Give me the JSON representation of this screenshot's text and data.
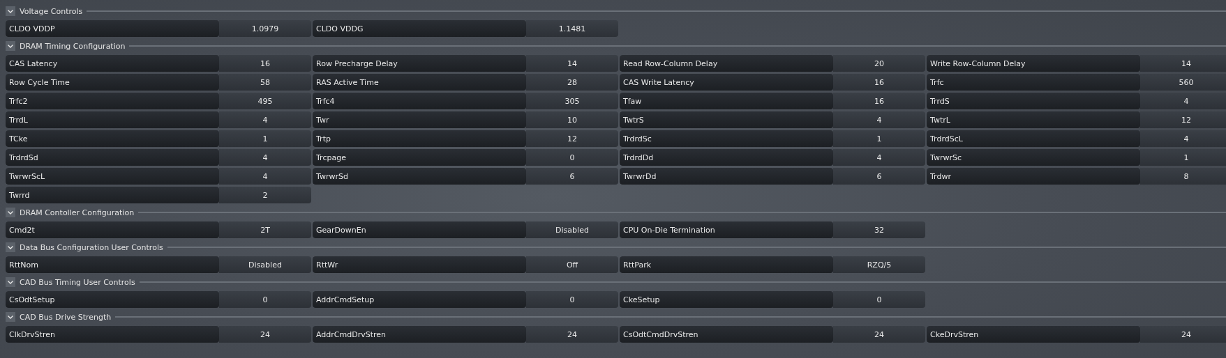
{
  "sections": [
    {
      "title": "Voltage Controls",
      "expanded": true,
      "items": [
        {
          "label": "CLDO VDDP",
          "value": "1.0979"
        },
        {
          "label": "CLDO VDDG",
          "value": "1.1481"
        }
      ]
    },
    {
      "title": "DRAM Timing Configuration",
      "expanded": true,
      "items": [
        {
          "label": "CAS Latency",
          "value": "16"
        },
        {
          "label": "Row Precharge Delay",
          "value": "14"
        },
        {
          "label": "Read Row-Column Delay",
          "value": "20"
        },
        {
          "label": "Write Row-Column Delay",
          "value": "14"
        },
        {
          "label": "Row Cycle Time",
          "value": "58"
        },
        {
          "label": "RAS Active Time",
          "value": "28"
        },
        {
          "label": "CAS Write Latency",
          "value": "16"
        },
        {
          "label": "Trfc",
          "value": "560"
        },
        {
          "label": "Trfc2",
          "value": "495"
        },
        {
          "label": "Trfc4",
          "value": "305"
        },
        {
          "label": "Tfaw",
          "value": "16"
        },
        {
          "label": "TrrdS",
          "value": "4"
        },
        {
          "label": "TrrdL",
          "value": "4"
        },
        {
          "label": "Twr",
          "value": "10"
        },
        {
          "label": "TwtrS",
          "value": "4"
        },
        {
          "label": "TwtrL",
          "value": "12"
        },
        {
          "label": "TCke",
          "value": "1"
        },
        {
          "label": "Trtp",
          "value": "12"
        },
        {
          "label": "TrdrdSc",
          "value": "1"
        },
        {
          "label": "TrdrdScL",
          "value": "4"
        },
        {
          "label": "TrdrdSd",
          "value": "4"
        },
        {
          "label": "Trcpage",
          "value": "0"
        },
        {
          "label": "TrdrdDd",
          "value": "4"
        },
        {
          "label": "TwrwrSc",
          "value": "1"
        },
        {
          "label": "TwrwrScL",
          "value": "4"
        },
        {
          "label": "TwrwrSd",
          "value": "6"
        },
        {
          "label": "TwrwrDd",
          "value": "6"
        },
        {
          "label": "Trdwr",
          "value": "8"
        },
        {
          "label": "Twrrd",
          "value": "2"
        }
      ]
    },
    {
      "title": "DRAM Contoller Configuration",
      "expanded": true,
      "items": [
        {
          "label": "Cmd2t",
          "value": "2T"
        },
        {
          "label": "GearDownEn",
          "value": "Disabled"
        },
        {
          "label": "CPU On-Die Termination",
          "value": "32"
        }
      ]
    },
    {
      "title": "Data Bus Configuration User Controls",
      "expanded": true,
      "items": [
        {
          "label": "RttNom",
          "value": "Disabled"
        },
        {
          "label": "RttWr",
          "value": "Off"
        },
        {
          "label": "RttPark",
          "value": "RZQ/5"
        }
      ]
    },
    {
      "title": "CAD Bus Timing User Controls",
      "expanded": true,
      "items": [
        {
          "label": "CsOdtSetup",
          "value": "0"
        },
        {
          "label": "AddrCmdSetup",
          "value": "0"
        },
        {
          "label": "CkeSetup",
          "value": "0"
        }
      ]
    },
    {
      "title": "CAD Bus Drive Strength",
      "expanded": true,
      "items": [
        {
          "label": "ClkDrvStren",
          "value": "24"
        },
        {
          "label": "AddrCmdDrvStren",
          "value": "24"
        },
        {
          "label": "CsOdtCmdDrvStren",
          "value": "24"
        },
        {
          "label": "CkeDrvStren",
          "value": "24"
        }
      ]
    }
  ]
}
